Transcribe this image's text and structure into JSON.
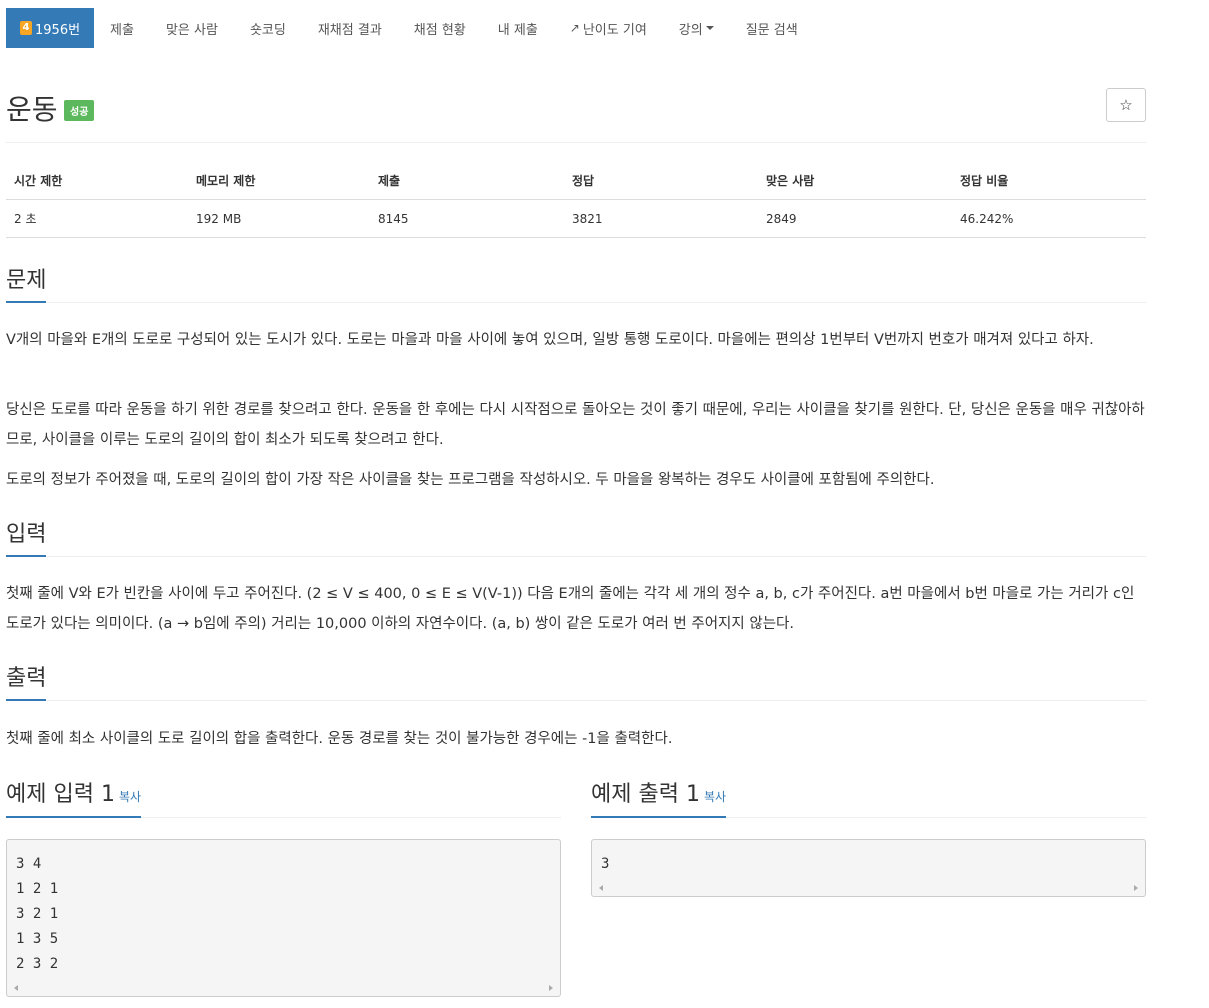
{
  "nav": {
    "tier": "4",
    "problem_id": "1956번",
    "items": [
      "제출",
      "맞은 사람",
      "숏코딩",
      "재채점 결과",
      "채점 현황",
      "내 제출",
      "난이도 기여",
      "강의",
      "질문 검색"
    ]
  },
  "problem": {
    "title": "운동",
    "badge": "성공",
    "star": "☆"
  },
  "info": {
    "headers": [
      "시간 제한",
      "메모리 제한",
      "제출",
      "정답",
      "맞은 사람",
      "정답 비율"
    ],
    "values": [
      "2 초",
      "192 MB",
      "8145",
      "3821",
      "2849",
      "46.242%"
    ]
  },
  "sections": {
    "problem_head": "문제",
    "problem_p1": "V개의 마을와 E개의 도로로 구성되어 있는 도시가 있다. 도로는 마을과 마을 사이에 놓여 있으며, 일방 통행 도로이다. 마을에는 편의상 1번부터 V번까지 번호가 매겨져 있다고 하자.",
    "problem_p2": "당신은 도로를 따라 운동을 하기 위한 경로를 찾으려고 한다. 운동을 한 후에는 다시 시작점으로 돌아오는 것이 좋기 때문에, 우리는 사이클을 찾기를 원한다. 단, 당신은 운동을 매우 귀찮아하므로, 사이클을 이루는 도로의 길이의 합이 최소가 되도록 찾으려고 한다.",
    "problem_p3": "도로의 정보가 주어졌을 때, 도로의 길이의 합이 가장 작은 사이클을 찾는 프로그램을 작성하시오. 두 마을을 왕복하는 경우도 사이클에 포함됨에 주의한다.",
    "input_head": "입력",
    "input_p": "첫째 줄에 V와 E가 빈칸을 사이에 두고 주어진다. (2 ≤ V ≤ 400, 0 ≤ E ≤ V(V-1)) 다음 E개의 줄에는 각각 세 개의 정수 a, b, c가 주어진다. a번 마을에서 b번 마을로 가는 거리가 c인 도로가 있다는 의미이다. (a → b임에 주의) 거리는 10,000 이하의 자연수이다. (a, b) 쌍이 같은 도로가 여러 번 주어지지 않는다.",
    "output_head": "출력",
    "output_p": "첫째 줄에 최소 사이클의 도로 길이의 합을 출력한다. 운동 경로를 찾는 것이 불가능한 경우에는 -1을 출력한다."
  },
  "samples": {
    "input_head": "예제 입력 1",
    "output_head": "예제 출력 1",
    "copy_label": "복사",
    "input_lines": [
      "3 4",
      "1 2 1",
      "3 2 1",
      "1 3 5",
      "2 3 2"
    ],
    "output_lines": [
      "3"
    ]
  }
}
